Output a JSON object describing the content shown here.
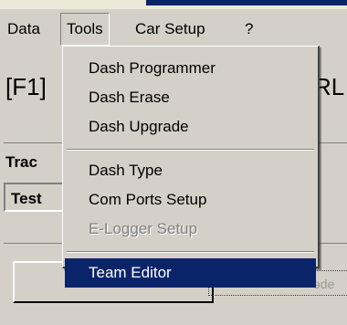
{
  "menubar": {
    "items": [
      "Data",
      "Tools",
      "Car Setup",
      "?"
    ],
    "active": "Tools"
  },
  "background": {
    "title_left": "[F1]",
    "title_right": "RL",
    "track_label": "Trac",
    "test_value": "Test"
  },
  "tools_menu": {
    "items": [
      {
        "label": "Dash Programmer",
        "enabled": true
      },
      {
        "label": "Dash Erase",
        "enabled": true
      },
      {
        "label": "Dash Upgrade",
        "enabled": true
      },
      {
        "label": "Dash Type",
        "enabled": true
      },
      {
        "label": "Com Ports Setup",
        "enabled": true
      },
      {
        "label": "E-Logger Setup",
        "enabled": false
      },
      {
        "label": "Team Editor",
        "enabled": true,
        "highlighted": true
      }
    ]
  },
  "colors": {
    "face": "#d4d0c8",
    "highlight": "#0a246a",
    "disabled_text": "#808080"
  }
}
